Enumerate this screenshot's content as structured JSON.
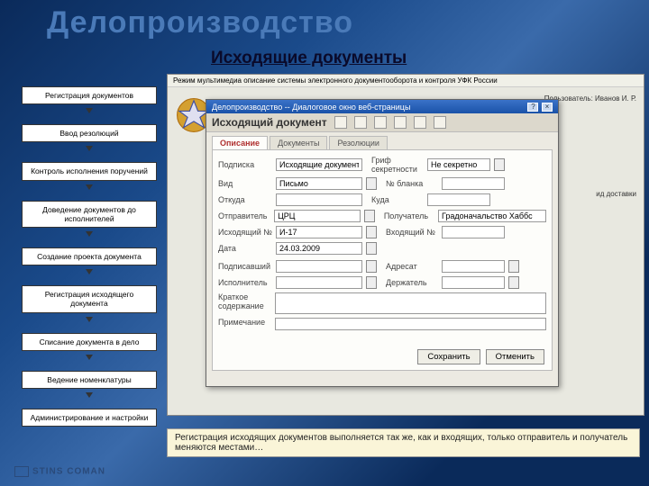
{
  "slide": {
    "title": "Делопроизводство",
    "subtitle": "Исходящие документы",
    "caption": "Регистрация исходящих документов выполняется так же, как и входящих, только отправитель и получатель меняются местами…",
    "logo": "STINS COMAN"
  },
  "process": [
    "Регистрация документов",
    "Ввод резолюций",
    "Контроль исполнения поручений",
    "Доведение документов до исполнителей",
    "Создание проекта документа",
    "Регистрация исходящего документа",
    "Списание документа в дело",
    "Ведение номенклатуры",
    "Администрирование и настройки"
  ],
  "browser": {
    "top": "Режим мультимедиа описание системы электронного документооборота и контроля УФК России",
    "user": "Пользователь: Иванов И. Р.",
    "col_extra": "ид доставки"
  },
  "dialog": {
    "title": "Делопроизводство -- Диалоговое окно веб-страницы",
    "heading": "Исходящий документ",
    "tabs": [
      "Описание",
      "Документы",
      "Резолюции"
    ],
    "labels": {
      "podpiska": "Подписка",
      "vid": "Вид",
      "otkuda": "Откуда",
      "otpravitel": "Отправитель",
      "iskh_no": "Исходящий №",
      "data": "Дата",
      "podpisavshiy": "Подписавший",
      "ispolnitel": "Исполнитель",
      "kratkoe": "Краткое содержание",
      "primechanie": "Примечание",
      "grif": "Гриф секретности",
      "no_blanka": "№ бланка",
      "kuda": "Куда",
      "poluchatel": "Получатель",
      "vkh_no": "Входящий №",
      "adresat": "Адресат",
      "derzhatel": "Держатель"
    },
    "values": {
      "podpiska": "Исходящие документы",
      "vid": "Письмо",
      "otpravitel": "ЦРЦ",
      "iskh_no": "И-17",
      "data": "24.03.2009",
      "grif": "Не секретно",
      "poluchatel": "Градоначальство Хаббс"
    },
    "buttons": {
      "save": "Сохранить",
      "cancel": "Отменить"
    }
  }
}
